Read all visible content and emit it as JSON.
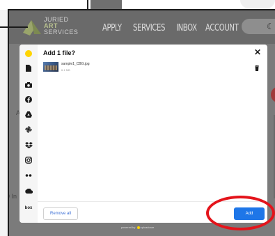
{
  "header": {
    "logo": {
      "line1": "JURIED",
      "line2": "ART",
      "line3": "SERVICES"
    },
    "nav": [
      "APPLY",
      "SERVICES",
      "INBOX",
      "ACCOUNT"
    ],
    "theme_icon": "moon-icon"
  },
  "background": {
    "left_fragment_1": "A",
    "left_fragment_2": "0 In"
  },
  "dialog": {
    "title": "Add 1 file?",
    "close_icon": "close-icon",
    "sources": [
      "uploadcare-icon",
      "file-icon",
      "camera-icon",
      "facebook-icon",
      "google-drive-icon",
      "google-photos-icon",
      "dropbox-icon",
      "instagram-icon",
      "flickr-icon",
      "onedrive-icon",
      "box-icon"
    ],
    "box_label": "box",
    "file": {
      "name": "sample1_CBG.jpg",
      "size": "6.1 MB"
    },
    "remove_all_label": "Remove all",
    "add_label": "Add",
    "powered_prefix": "powered by",
    "powered_brand": "uploadcare"
  },
  "colors": {
    "accent_blue": "#1e76e8",
    "annotation_red": "#e4141b",
    "uploadcare_yellow": "#ffd400"
  }
}
